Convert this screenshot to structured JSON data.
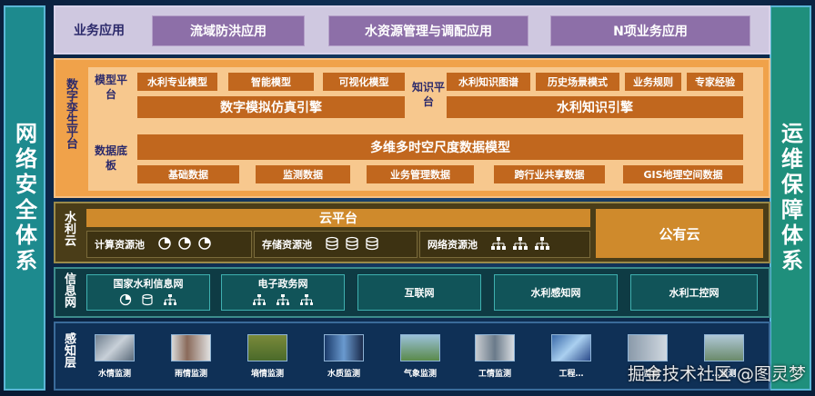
{
  "left_side": {
    "label": "网络安全体系"
  },
  "right_side": {
    "label": "运维保障体系"
  },
  "business": {
    "label": "业务应用",
    "items": [
      "流域防洪应用",
      "水资源管理与调配应用",
      "N项业务应用"
    ]
  },
  "twin": {
    "label": "数字孪生平台",
    "model_label": "模型平台",
    "model_items": [
      "水利专业模型",
      "智能模型",
      "可视化模型"
    ],
    "model_engine": "数字模拟仿真引擎",
    "knowledge_label": "知识平台",
    "knowledge_items": [
      "水利知识图谱",
      "历史场景模式",
      "业务规则",
      "专家经验"
    ],
    "knowledge_engine": "水利知识引擎",
    "data_label": "数据底板",
    "data_model": "多维多时空尺度数据模型",
    "data_items": [
      "基础数据",
      "监测数据",
      "业务管理数据",
      "跨行业共享数据",
      "GIS地理空间数据"
    ]
  },
  "cloud": {
    "label": "水利云",
    "platform": "云平台",
    "pools": [
      "计算资源池",
      "存储资源池",
      "网络资源池"
    ],
    "public": "公有云"
  },
  "network": {
    "label": "信息网",
    "items": [
      "国家水利信息网",
      "电子政务网",
      "互联网",
      "水利感知网",
      "水利工控网"
    ]
  },
  "sensing": {
    "label": "感知层",
    "items": [
      "水情监测",
      "雨情监测",
      "墒情监测",
      "水质监测",
      "气象监测",
      "工情监测",
      "工程…",
      "…监测",
      "…监测"
    ]
  },
  "watermark": "掘金技术社区 @图灵梦"
}
